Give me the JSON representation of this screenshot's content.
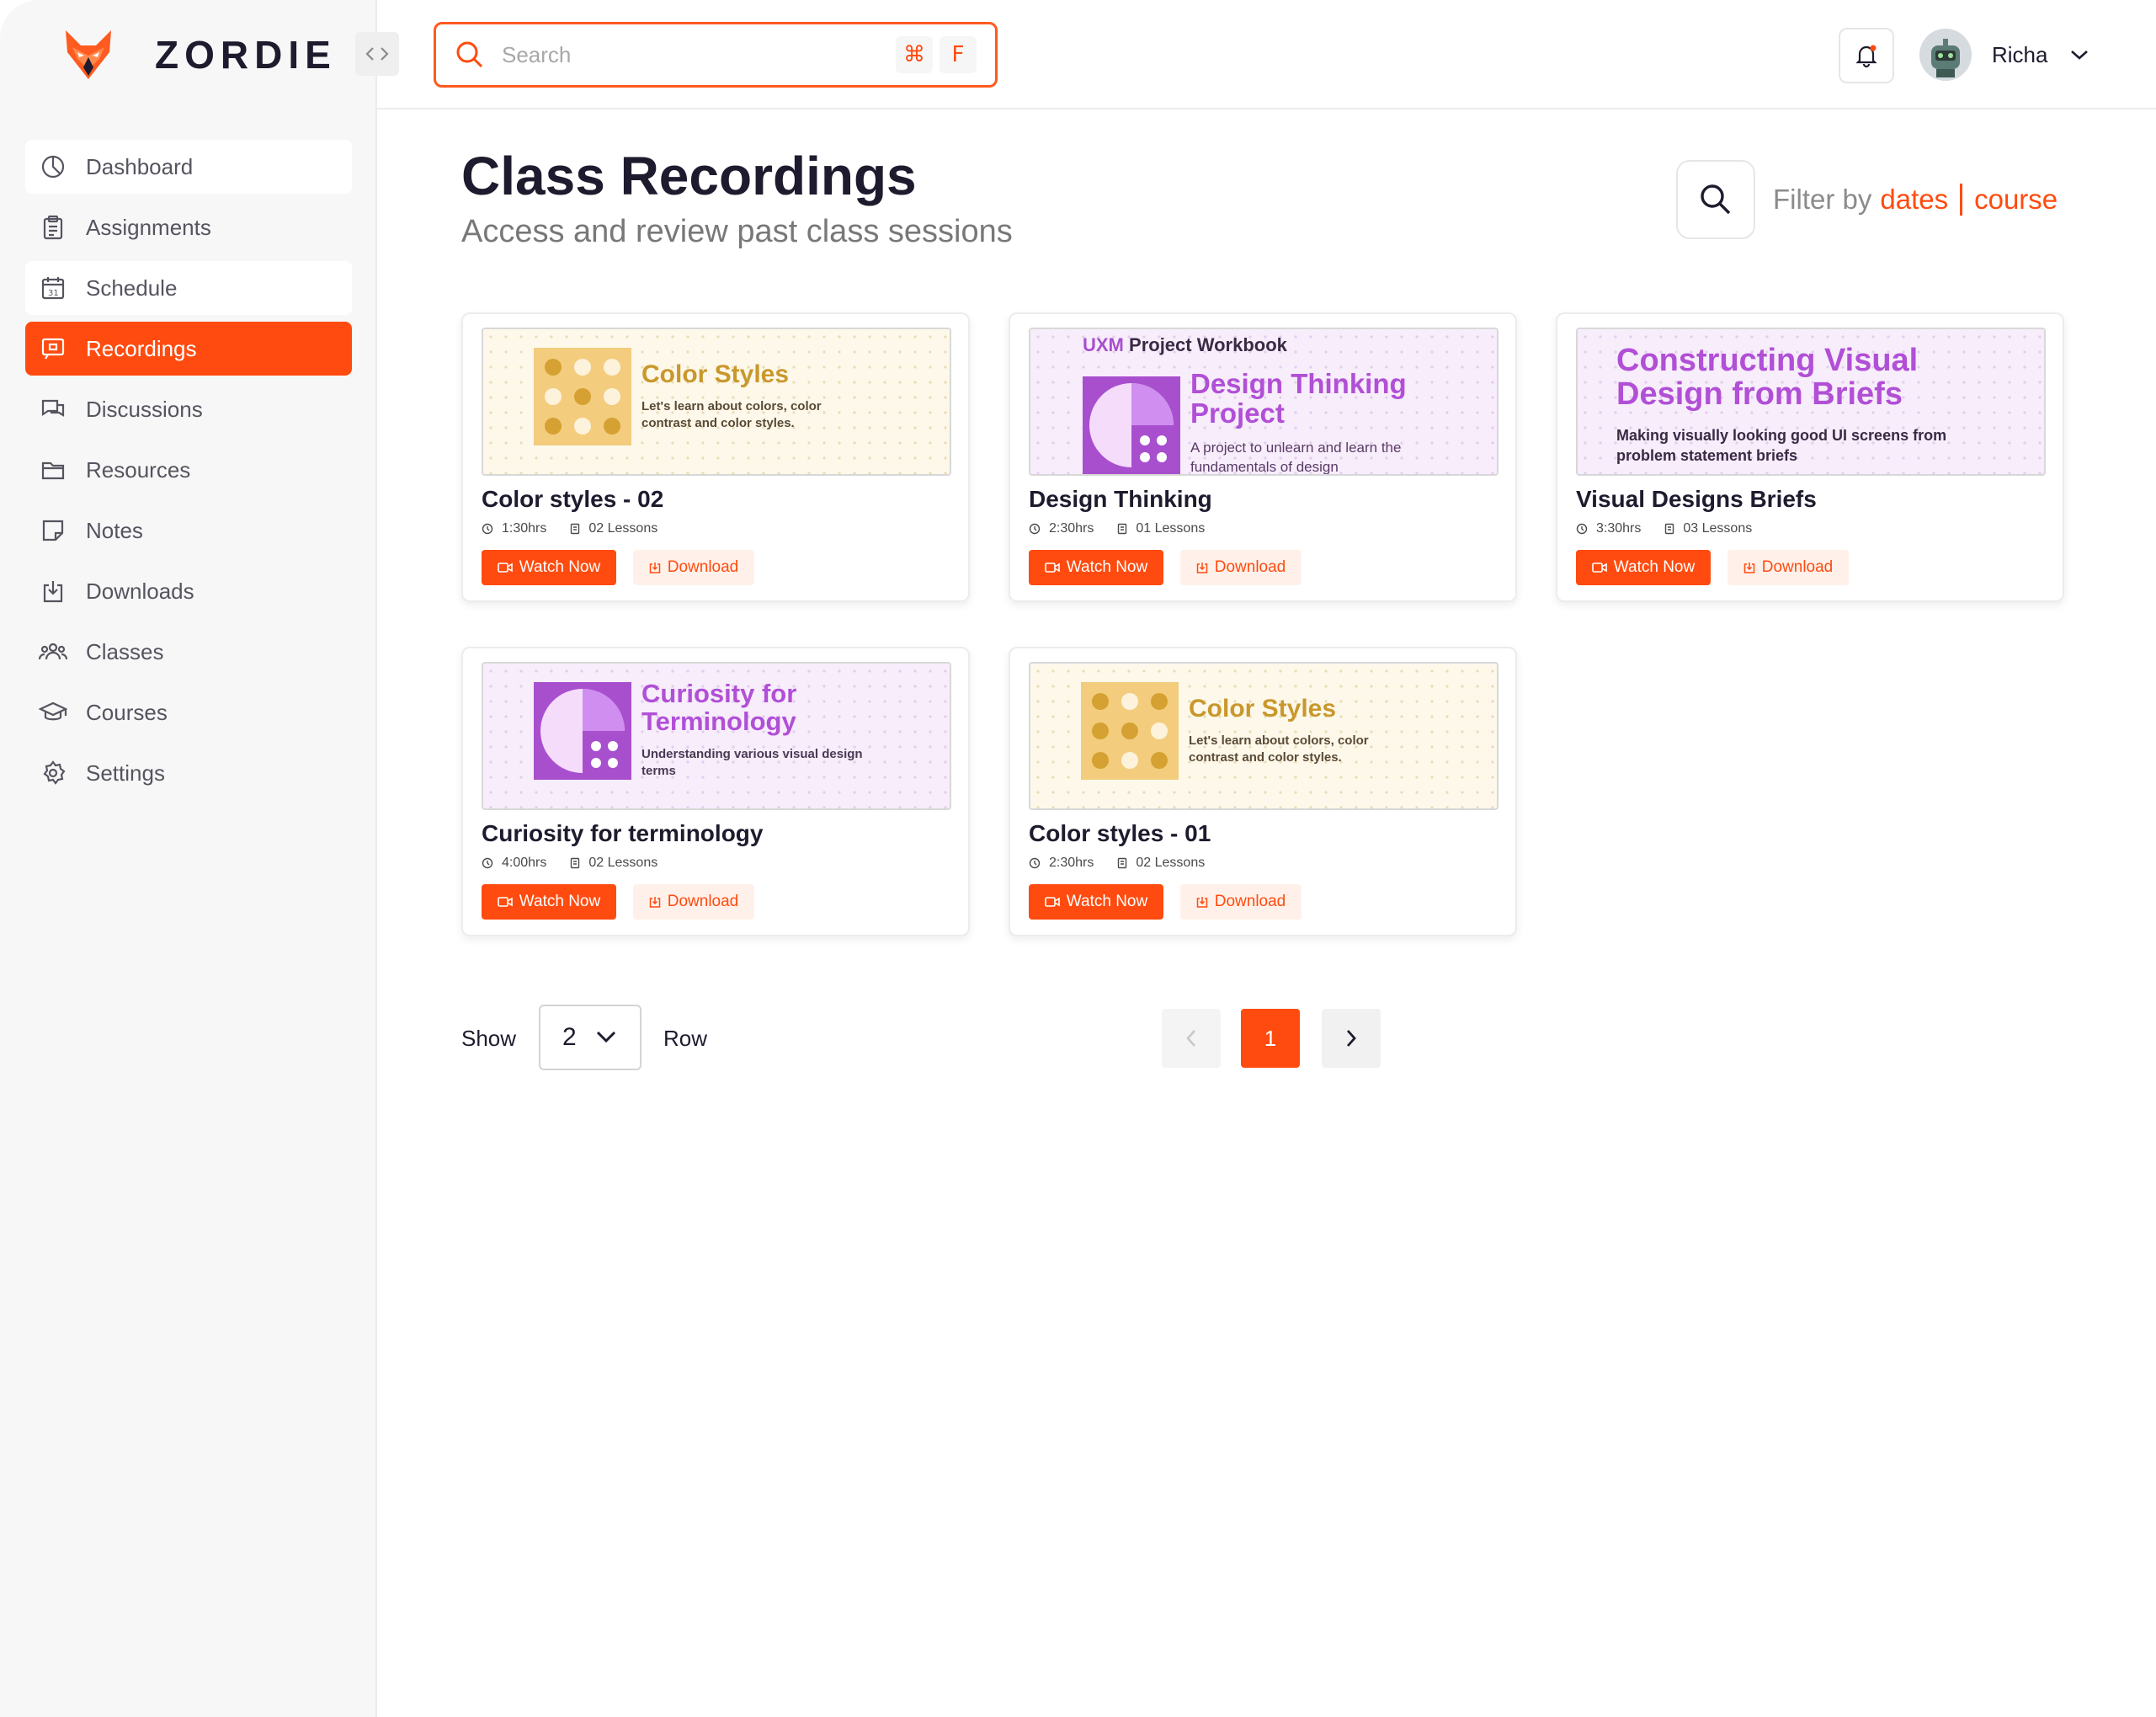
{
  "app": {
    "brand": "ZORDIE"
  },
  "search": {
    "placeholder": "Search",
    "shortcut_symbol": "⌘",
    "shortcut_key": "F"
  },
  "user": {
    "name": "Richa"
  },
  "sidebar": {
    "items": [
      {
        "label": "Dashboard",
        "icon": "dashboard-icon"
      },
      {
        "label": "Assignments",
        "icon": "clipboard-icon"
      },
      {
        "label": "Schedule",
        "icon": "calendar-icon"
      },
      {
        "label": "Recordings",
        "icon": "recording-icon",
        "active": true
      },
      {
        "label": "Discussions",
        "icon": "chat-icon"
      },
      {
        "label": "Resources",
        "icon": "folder-icon"
      },
      {
        "label": "Notes",
        "icon": "note-icon"
      },
      {
        "label": "Downloads",
        "icon": "download-icon"
      },
      {
        "label": "Classes",
        "icon": "users-icon"
      },
      {
        "label": "Courses",
        "icon": "graduation-cap-icon"
      },
      {
        "label": "Settings",
        "icon": "gear-icon"
      }
    ]
  },
  "page": {
    "title": "Class Recordings",
    "subtitle": "Access and review past class sessions"
  },
  "filter": {
    "prefix": "Filter by",
    "option_dates": "dates",
    "option_course": "course"
  },
  "cards": [
    {
      "title": "Color styles - 02",
      "duration": "1:30hrs",
      "lessons": "02 Lessons",
      "watch": "Watch Now",
      "download": "Download",
      "thumb": {
        "heading": "Color Styles",
        "desc": "Let's learn about colors, color contrast and  color styles."
      }
    },
    {
      "title": "Design Thinking",
      "duration": "2:30hrs",
      "lessons": "01 Lessons",
      "watch": "Watch Now",
      "download": "Download",
      "thumb": {
        "tag_accent": "UXM",
        "tag_rest": "Project Workbook",
        "heading": "Design Thinking Project",
        "desc": "A project to unlearn and learn the fundamentals of design"
      }
    },
    {
      "title": "Visual Designs Briefs",
      "duration": "3:30hrs",
      "lessons": "03 Lessons",
      "watch": "Watch Now",
      "download": "Download",
      "thumb": {
        "heading": "Constructing Visual Design from Briefs",
        "desc": "Making visually looking good UI screens from problem statement briefs"
      }
    },
    {
      "title": "Curiosity for terminology",
      "duration": "4:00hrs",
      "lessons": "02 Lessons",
      "watch": "Watch Now",
      "download": "Download",
      "thumb": {
        "heading": "Curiosity for Terminology",
        "desc": "Understanding various visual design terms"
      }
    },
    {
      "title": "Color styles - 01",
      "duration": "2:30hrs",
      "lessons": "02 Lessons",
      "watch": "Watch Now",
      "download": "Download",
      "thumb": {
        "heading": "Color Styles",
        "desc": "Let's learn about colors, color contrast and  color styles."
      }
    }
  ],
  "pagination": {
    "show_label": "Show",
    "rows_value": "2",
    "row_label": "Row",
    "current_page": "1"
  },
  "colors": {
    "accent": "#ff4b0f",
    "purple": "#a84fce",
    "gold": "#c9982c"
  }
}
